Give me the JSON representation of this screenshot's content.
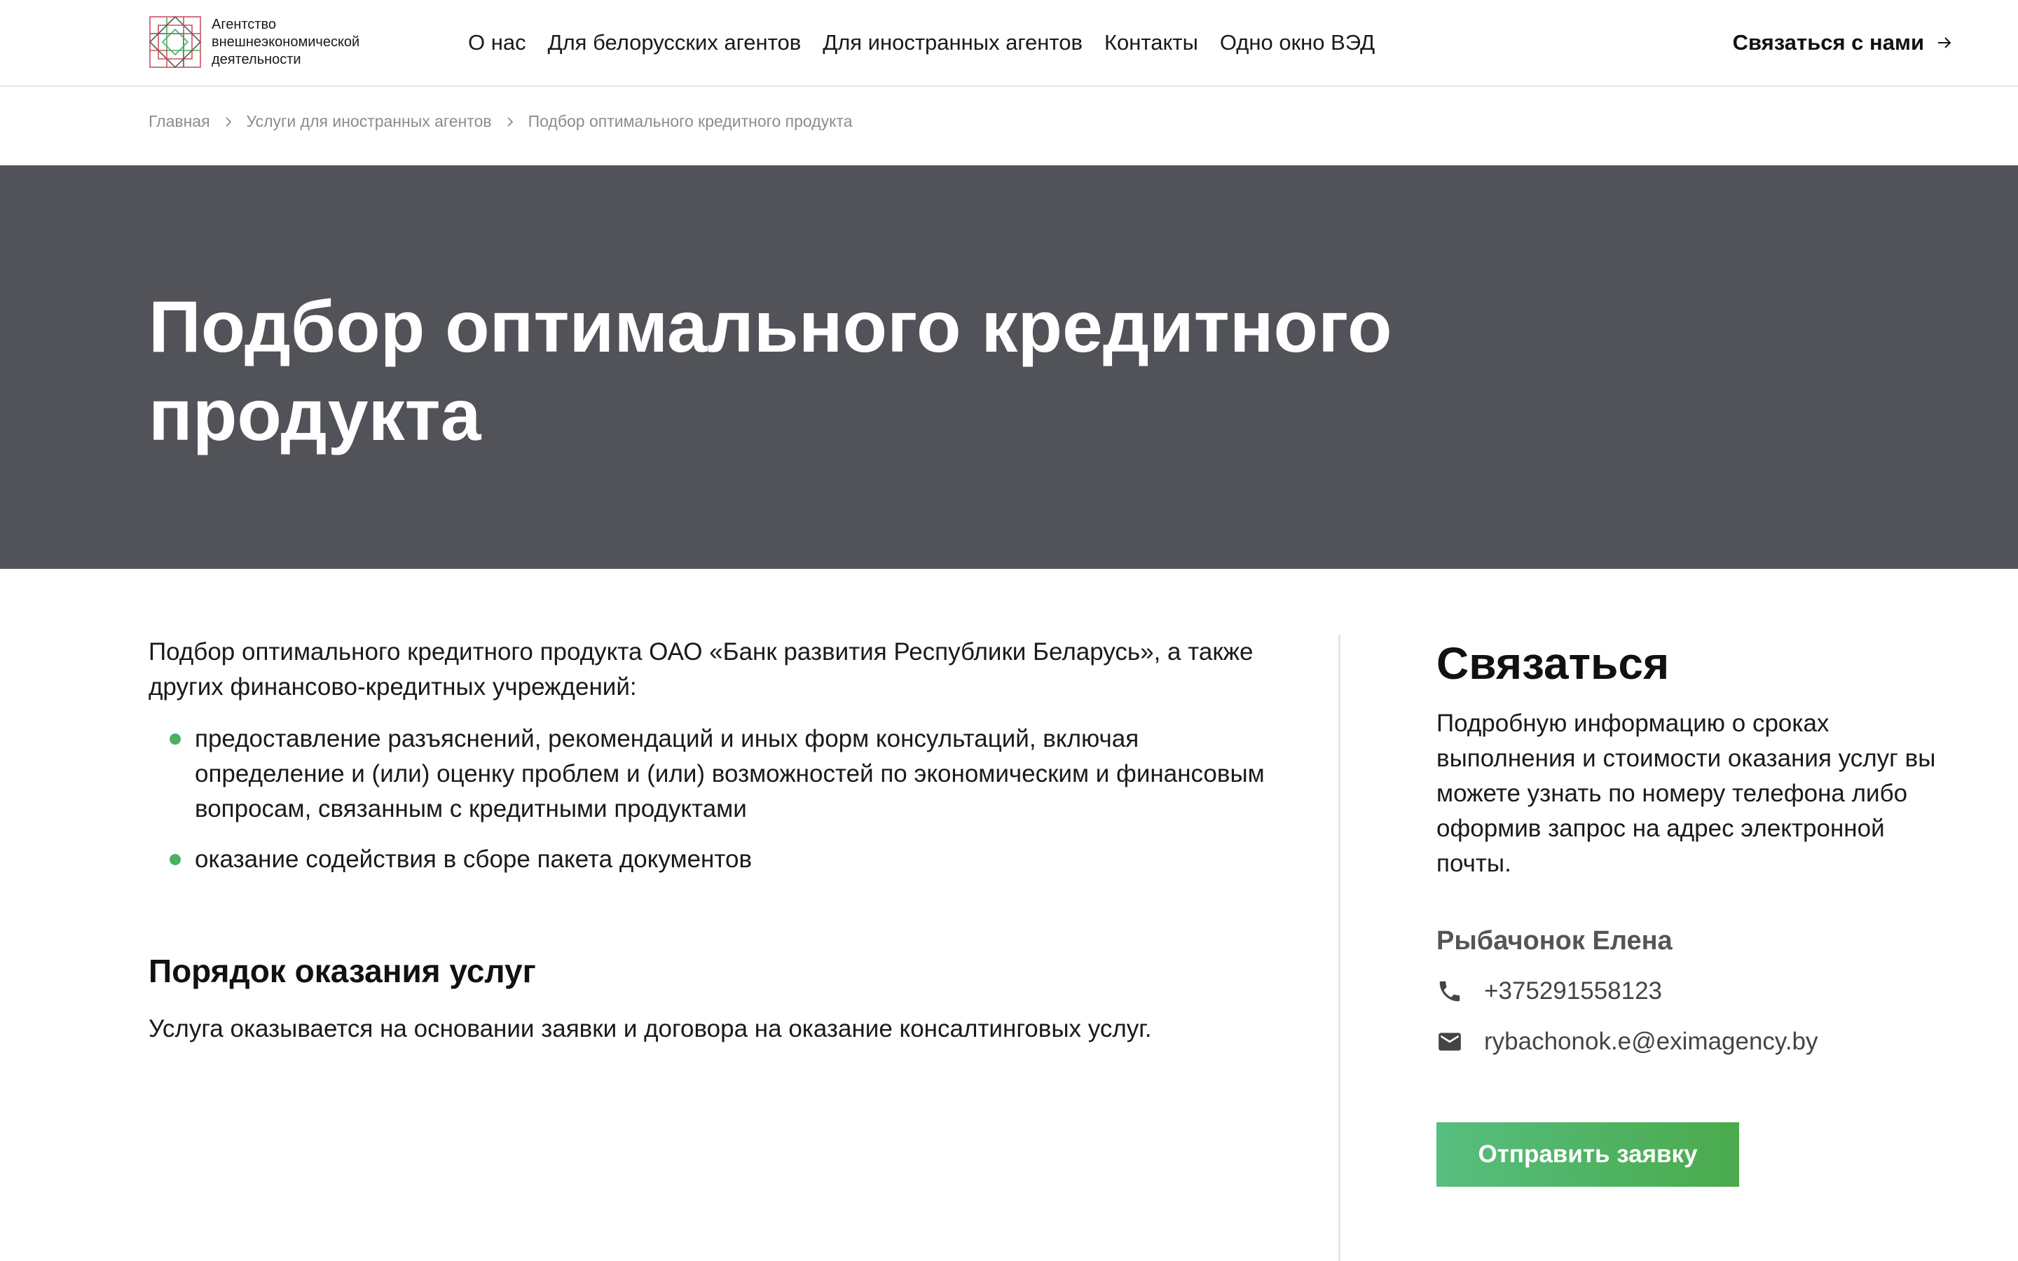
{
  "header": {
    "logo_text": "Агентство\nвнешнеэкономической\nдеятельности",
    "nav": [
      {
        "label": "О нас"
      },
      {
        "label": "Для белорусских агентов"
      },
      {
        "label": "Для иностранных агентов"
      },
      {
        "label": "Контакты"
      },
      {
        "label": "Одно окно ВЭД"
      }
    ],
    "cta_label": "Связаться с нами",
    "cta_icon": "arrow-right-icon"
  },
  "breadcrumb": [
    {
      "label": "Главная"
    },
    {
      "label": "Услуги для иностранных агентов"
    },
    {
      "label": "Подбор оптимального кредитного продукта"
    }
  ],
  "hero": {
    "title": "Подбор оптимального кредитного продукта"
  },
  "main": {
    "intro": "Подбор оптимального кредитного продукта ОАО «Банк развития Республики Беларусь», а также других финансово-кредитных учреждений:",
    "bullets": [
      "предоставление разъяснений, рекомендаций и иных форм консультаций, включая определение и (или) оценку проблем и (или) возможностей по экономическим и финансовым вопросам, связанным с кредитными продуктами",
      "оказание содействия в сборе пакета документов"
    ],
    "section_title": "Порядок оказания услуг",
    "section_text": "Услуга оказывается на основании заявки и договора на оказание консалтинговых услуг."
  },
  "sidebar": {
    "title": "Связаться",
    "text": "Подробную информацию о сроках выполнения и стоимости оказания услуг вы можете узнать по номеру телефона либо оформив запрос на адрес электронной почты.",
    "contact_name": "Рыбачонок Елена",
    "phone": "+375291558123",
    "email": "rybachonok.e@eximagency.by",
    "submit_label": "Отправить заявку"
  },
  "colors": {
    "hero_bg": "#525358",
    "accent_green": "#4caf62",
    "button_gradient_start": "#56be7f",
    "button_gradient_end": "#4aaa4c"
  }
}
